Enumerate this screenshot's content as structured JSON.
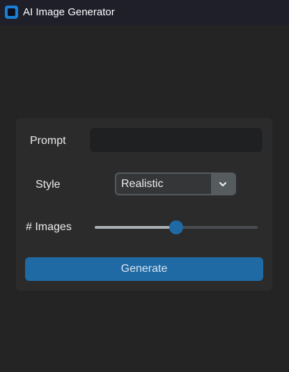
{
  "window": {
    "title": "AI Image Generator",
    "icon": "app-icon"
  },
  "form": {
    "prompt": {
      "label": "Prompt",
      "value": "",
      "placeholder": ""
    },
    "style": {
      "label": "Style",
      "selected": "Realistic",
      "icon": "chevron-down-icon"
    },
    "images": {
      "label": "# Images",
      "slider_fraction": 0.5
    },
    "generate_label": "Generate"
  },
  "colors": {
    "accent": "#1f6aa5",
    "background": "#242424",
    "panel": "#2b2b2b",
    "titlebar": "#1e1f29"
  }
}
